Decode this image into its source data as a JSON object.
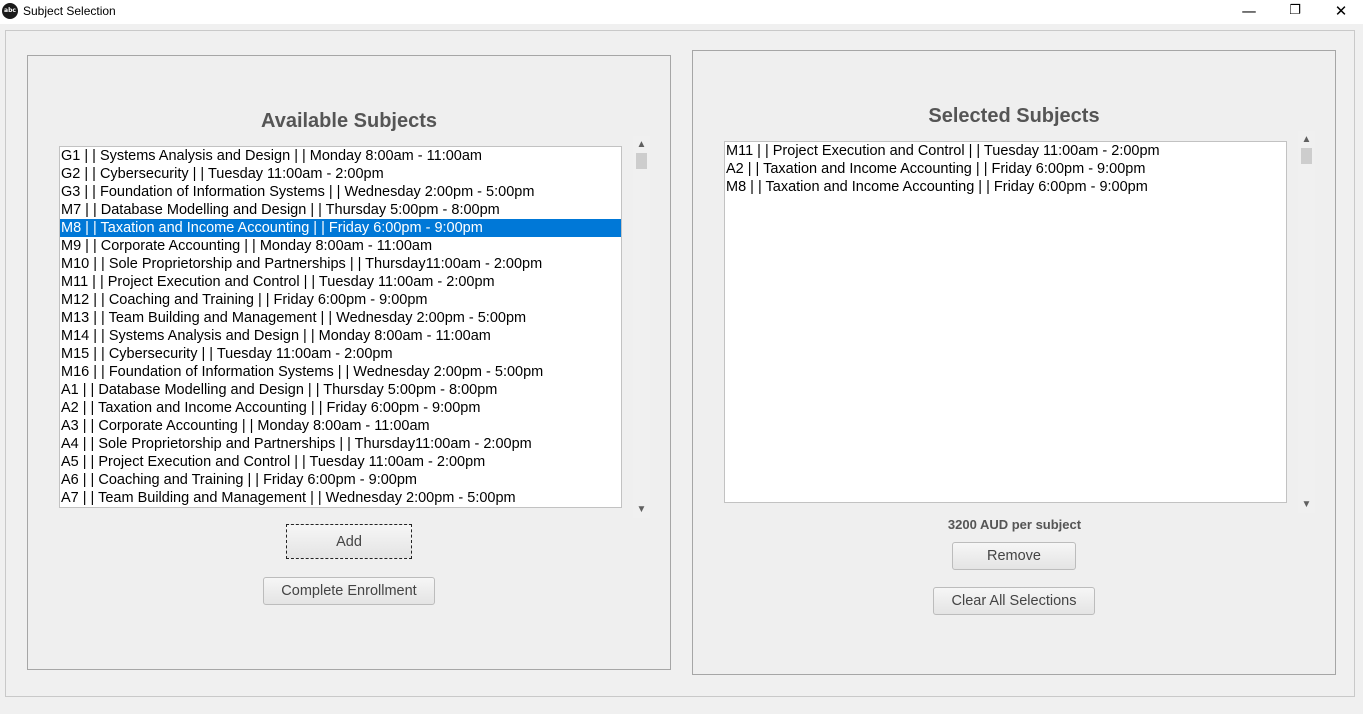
{
  "window": {
    "title": "Subject Selection",
    "icon_text": "abc",
    "controls": {
      "minimize": "—",
      "maximize": "❐",
      "close": "✕"
    }
  },
  "available": {
    "heading": "Available Subjects",
    "items": [
      "G1 |  | Systems Analysis and Design |  | Monday 8:00am - 11:00am",
      "G2 |  | Cybersecurity |  | Tuesday 11:00am - 2:00pm",
      "G3 |  | Foundation of Information Systems |  | Wednesday 2:00pm - 5:00pm",
      "M7 |  | Database Modelling and Design |  | Thursday 5:00pm - 8:00pm",
      "M8 |  | Taxation and Income Accounting |  | Friday 6:00pm - 9:00pm",
      "M9 |  | Corporate Accounting |  | Monday 8:00am - 11:00am",
      "M10 |  | Sole Proprietorship and Partnerships |  | Thursday11:00am - 2:00pm",
      "M11 |  | Project Execution and Control |  | Tuesday 11:00am - 2:00pm",
      "M12 |  | Coaching and Training |  | Friday 6:00pm - 9:00pm",
      "M13 |  | Team Building and Management |  | Wednesday 2:00pm - 5:00pm",
      "M14 |  | Systems Analysis and Design |  | Monday 8:00am - 11:00am",
      "M15 |  | Cybersecurity |  | Tuesday 11:00am - 2:00pm",
      "M16 |  | Foundation of Information Systems |  | Wednesday 2:00pm - 5:00pm",
      "A1 |  | Database Modelling and Design |  | Thursday 5:00pm - 8:00pm",
      "A2 |  | Taxation and Income Accounting |  | Friday 6:00pm - 9:00pm",
      "A3 |  | Corporate Accounting |  | Monday 8:00am - 11:00am",
      "A4 |  | Sole Proprietorship and Partnerships |  | Thursday11:00am - 2:00pm",
      "A5 |  | Project Execution and Control |  | Tuesday 11:00am - 2:00pm",
      "A6 |  | Coaching and Training |  | Friday 6:00pm - 9:00pm",
      "A7 |  | Team Building and Management |  | Wednesday 2:00pm - 5:00pm"
    ],
    "selected_index": 4,
    "add_label": "Add",
    "complete_label": "Complete Enrollment"
  },
  "selected": {
    "heading": "Selected Subjects",
    "items": [
      "M11 |  | Project Execution and Control |  | Tuesday 11:00am - 2:00pm",
      "A2 |  | Taxation and Income Accounting |  | Friday 6:00pm - 9:00pm",
      "M8 |  | Taxation and Income Accounting |  | Friday 6:00pm - 9:00pm"
    ],
    "price_note": "3200 AUD per subject",
    "remove_label": "Remove",
    "clear_label": "Clear All Selections"
  },
  "scroll_arrows": {
    "up": "▲",
    "down": "▼"
  },
  "colors": {
    "selection": "#0078d7",
    "heading": "#555555"
  }
}
